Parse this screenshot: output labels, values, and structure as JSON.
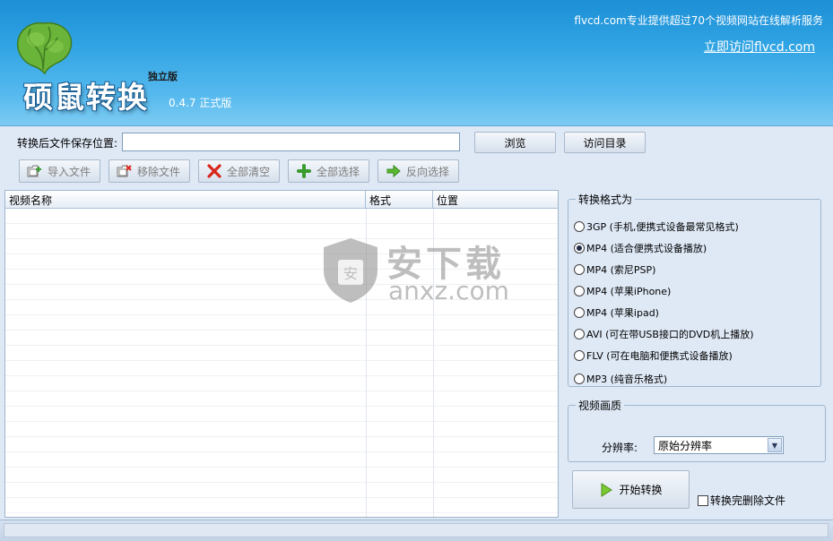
{
  "header": {
    "app_title": "硕鼠转换",
    "edition": "独立版",
    "version": "0.4.7  正式版",
    "tagline": "flvcd.com专业提供超过70个视频网站在线解析服务",
    "visit_link": "立即访问flvcd.com"
  },
  "save": {
    "label": "转换后文件保存位置:",
    "value": "",
    "browse_label": "浏览",
    "open_dir_label": "访问目录"
  },
  "toolbar": {
    "import": "导入文件",
    "remove": "移除文件",
    "clear_all": "全部清空",
    "select_all": "全部选择",
    "invert_select": "反向选择"
  },
  "file_list": {
    "columns": [
      "视频名称",
      "格式",
      "位置"
    ],
    "rows": []
  },
  "watermark": {
    "text_cn": "安下载",
    "text_en": "anxz.com",
    "badge": "安"
  },
  "format_group": {
    "legend": "转换格式为",
    "options": [
      {
        "label": "3GP (手机,便携式设备最常见格式)",
        "checked": false
      },
      {
        "label": "MP4 (适合便携式设备播放)",
        "checked": true
      },
      {
        "label": "MP4 (索尼PSP)",
        "checked": false
      },
      {
        "label": "MP4 (苹果iPhone)",
        "checked": false
      },
      {
        "label": "MP4 (苹果ipad)",
        "checked": false
      },
      {
        "label": "AVI  (可在带USB接口的DVD机上播放)",
        "checked": false
      },
      {
        "label": "FLV  (可在电脑和便携式设备播放)",
        "checked": false
      },
      {
        "label": "MP3 (纯音乐格式)",
        "checked": false
      }
    ]
  },
  "quality_group": {
    "legend": "视频画质",
    "resolution_label": "分辨率:",
    "resolution_value": "原始分辨率"
  },
  "actions": {
    "start_label": "开始转换",
    "delete_after_label": "转换完删除文件",
    "delete_after_checked": false
  },
  "colors": {
    "header_top": "#1d8fd6",
    "header_bottom": "#7dcbf2",
    "panel_bg": "#dfe9f6"
  }
}
